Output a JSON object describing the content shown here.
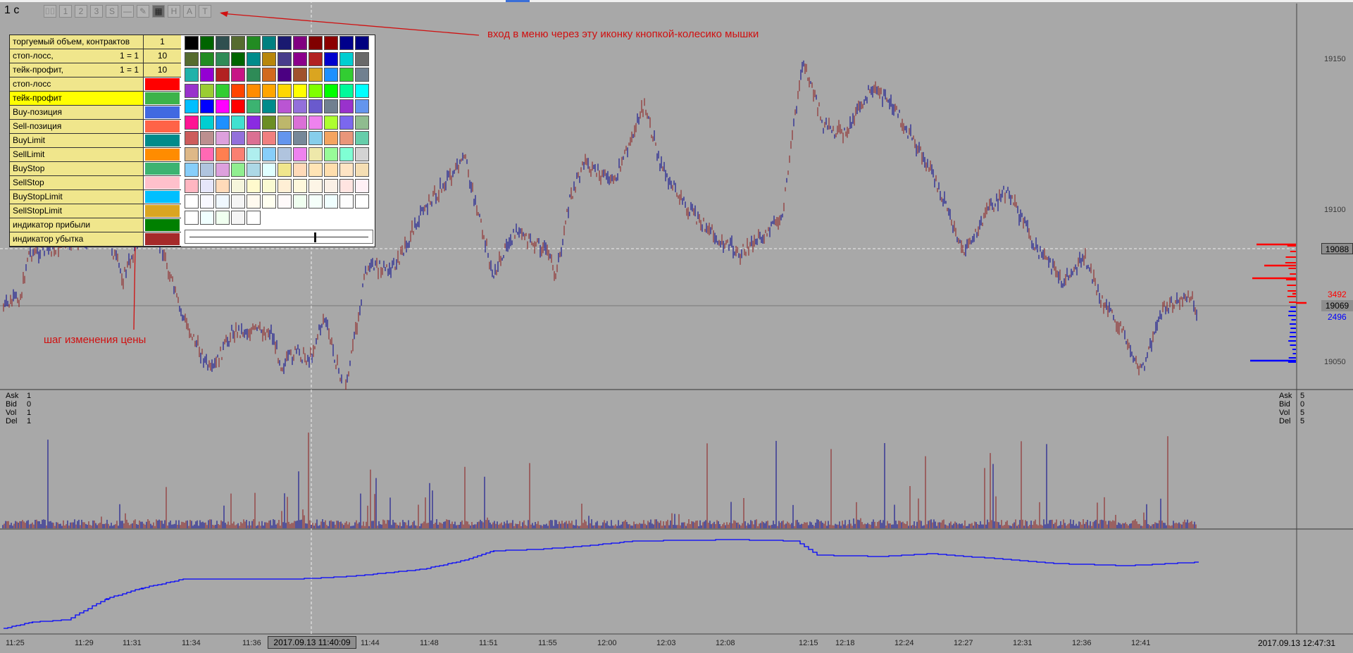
{
  "header": {
    "timeframe": "1 с",
    "toolbar": [
      {
        "icon": "bars-icon",
        "label": "⌷⌷"
      },
      {
        "icon": "one-icon",
        "label": "1"
      },
      {
        "icon": "two-icon",
        "label": "2"
      },
      {
        "icon": "three-icon",
        "label": "3"
      },
      {
        "icon": "s-icon",
        "label": "S"
      },
      {
        "icon": "line-icon",
        "label": "—"
      },
      {
        "icon": "pencil-icon",
        "label": "✎"
      },
      {
        "icon": "grid-menu-icon",
        "label": "▦"
      },
      {
        "icon": "h-icon",
        "label": "H"
      },
      {
        "icon": "a-icon",
        "label": "A"
      },
      {
        "icon": "t-icon",
        "label": "T"
      }
    ]
  },
  "annotations": {
    "menu_hint": "вход в меню через эту иконку кнопкой-колесико мышки",
    "step_hint": "шаг изменения цены"
  },
  "settings": {
    "volume": {
      "label": "торгуемый объем, контрактов",
      "value": "1"
    },
    "stop_loss": {
      "label": "стоп-лосс,",
      "ratio": "1 = 1",
      "value": "10"
    },
    "take_profit": {
      "label": "тейк-профит,",
      "ratio_prefix": "1 =",
      "ratio_value": "1",
      "value": "10"
    },
    "colors": [
      {
        "label": "стоп-лосс",
        "color": "#ff0000"
      },
      {
        "label": "тейк-профит",
        "color": "#3cb34a",
        "selected": true
      },
      {
        "label": "Buy-позиция",
        "color": "#4169e1"
      },
      {
        "label": "Sell-позиция",
        "color": "#ff6347"
      },
      {
        "label": "BuyLimit",
        "color": "#008b8b"
      },
      {
        "label": "SellLimit",
        "color": "#ff8c00"
      },
      {
        "label": "BuyStop",
        "color": "#3cb371"
      },
      {
        "label": "SellStop",
        "color": "#ffc0cb"
      },
      {
        "label": "BuyStopLimit",
        "color": "#00bfff"
      },
      {
        "label": "SellStopLimit",
        "color": "#daa520"
      },
      {
        "label": "индикатор прибыли",
        "color": "#008000"
      },
      {
        "label": "индикатор убытка",
        "color": "#a52a2a"
      }
    ]
  },
  "palette": [
    [
      "#000000",
      "#006400",
      "#2f4f4f",
      "#556b2f",
      "#228b22",
      "#008080",
      "#191970",
      "#800080",
      "#800000",
      "#8b0000",
      "#00008b",
      "#000080"
    ],
    [
      "#556b2f",
      "#228b22",
      "#2e8b57",
      "#006400",
      "#008b8b",
      "#b8860b",
      "#483d8b",
      "#8b008b",
      "#b22222",
      "#0000cd",
      "#00ced1",
      "#696969"
    ],
    [
      "#20b2aa",
      "#9400d3",
      "#b22222",
      "#c71585",
      "#2e8b57",
      "#d2691e",
      "#4b0082",
      "#a0522d",
      "#daa520",
      "#1e90ff",
      "#32cd32",
      "#708090"
    ],
    [
      "#9932cc",
      "#9acd32",
      "#32cd32",
      "#ff4500",
      "#ff8c00",
      "#ffa500",
      "#ffd700",
      "#ffff00",
      "#7fff00",
      "#00ff00",
      "#00fa9a",
      "#00ffff"
    ],
    [
      "#00bfff",
      "#0000ff",
      "#ff00ff",
      "#ff0000",
      "#3cb371",
      "#008b8b",
      "#ba55d3",
      "#9370db",
      "#6a5acd",
      "#708090",
      "#9932cc",
      "#6495ed"
    ],
    [
      "#ff1493",
      "#00ced1",
      "#1e90ff",
      "#40e0d0",
      "#8a2be2",
      "#6b8e23",
      "#bdb76b",
      "#da70d6",
      "#ee82ee",
      "#adff2f",
      "#7b68ee",
      "#8fbc8f"
    ],
    [
      "#cd5c5c",
      "#bc8f8f",
      "#dda0dd",
      "#9370db",
      "#db7093",
      "#f08080",
      "#6495ed",
      "#778899",
      "#87ceeb",
      "#f4a460",
      "#e9967a",
      "#66cdaa"
    ],
    [
      "#deb887",
      "#ff69b4",
      "#ff7f50",
      "#fa8072",
      "#afeeee",
      "#87cefa",
      "#b0c4de",
      "#ee82ee",
      "#eee8aa",
      "#98fb98",
      "#7fffd4",
      "#d3d3d3"
    ],
    [
      "#87cefa",
      "#b0c4de",
      "#dda0dd",
      "#90ee90",
      "#add8e6",
      "#e0ffff",
      "#f0e68c",
      "#ffdab9",
      "#ffe4b5",
      "#ffdead",
      "#ffe4c4",
      "#f5deb3"
    ],
    [
      "#ffb6c1",
      "#e6e6fa",
      "#ffdab9",
      "#f5f5dc",
      "#fffacd",
      "#fafad2",
      "#ffefd5",
      "#fff8dc",
      "#fdf5e6",
      "#faf0e6",
      "#ffe4e1",
      "#fff0f5"
    ],
    [
      "#ffffff",
      "#f8f8ff",
      "#f0f8ff",
      "#f5f5f5",
      "#fffaf0",
      "#fffff0",
      "#fffafa",
      "#f0fff0",
      "#f5fffa",
      "#f0ffff",
      "#fdfdfd",
      "#ffffff"
    ],
    [
      "#ffffff",
      "#f0ffff",
      "#f0fff0",
      "#f5f5f5",
      "#ffffff"
    ]
  ],
  "price_scale": {
    "ticks": [
      "19150",
      "19100",
      "19050"
    ],
    "current": "19069",
    "level": "19088",
    "ask_count": "3492",
    "bid_count": "2496"
  },
  "stats_left": [
    {
      "k": "Ask",
      "v": "1"
    },
    {
      "k": "Bid",
      "v": "0"
    },
    {
      "k": "Vol",
      "v": "1"
    },
    {
      "k": "Del",
      "v": "1"
    }
  ],
  "stats_right": [
    {
      "k": "Ask",
      "v": "5"
    },
    {
      "k": "Bid",
      "v": "0"
    },
    {
      "k": "Vol",
      "v": "5"
    },
    {
      "k": "Del",
      "v": "5"
    }
  ],
  "time_axis": {
    "ticks": [
      "11:25",
      "11:29",
      "11:31",
      "11:34",
      "11:36",
      "11:44",
      "11:48",
      "11:51",
      "11:55",
      "12:00",
      "12:03",
      "12:08",
      "12:15",
      "12:18",
      "12:24",
      "12:27",
      "12:31",
      "12:36",
      "12:41"
    ],
    "crosshair": "2017.09.13 11:40:09",
    "last": "2017.09.13 12:47:31"
  },
  "colors": {
    "background": "#a8a8a8",
    "ask_color": "#ff0000",
    "bid_color": "#0000ff",
    "price_up": "#00008b",
    "price_down": "#8b1a1a",
    "annotation": "#d01010"
  }
}
